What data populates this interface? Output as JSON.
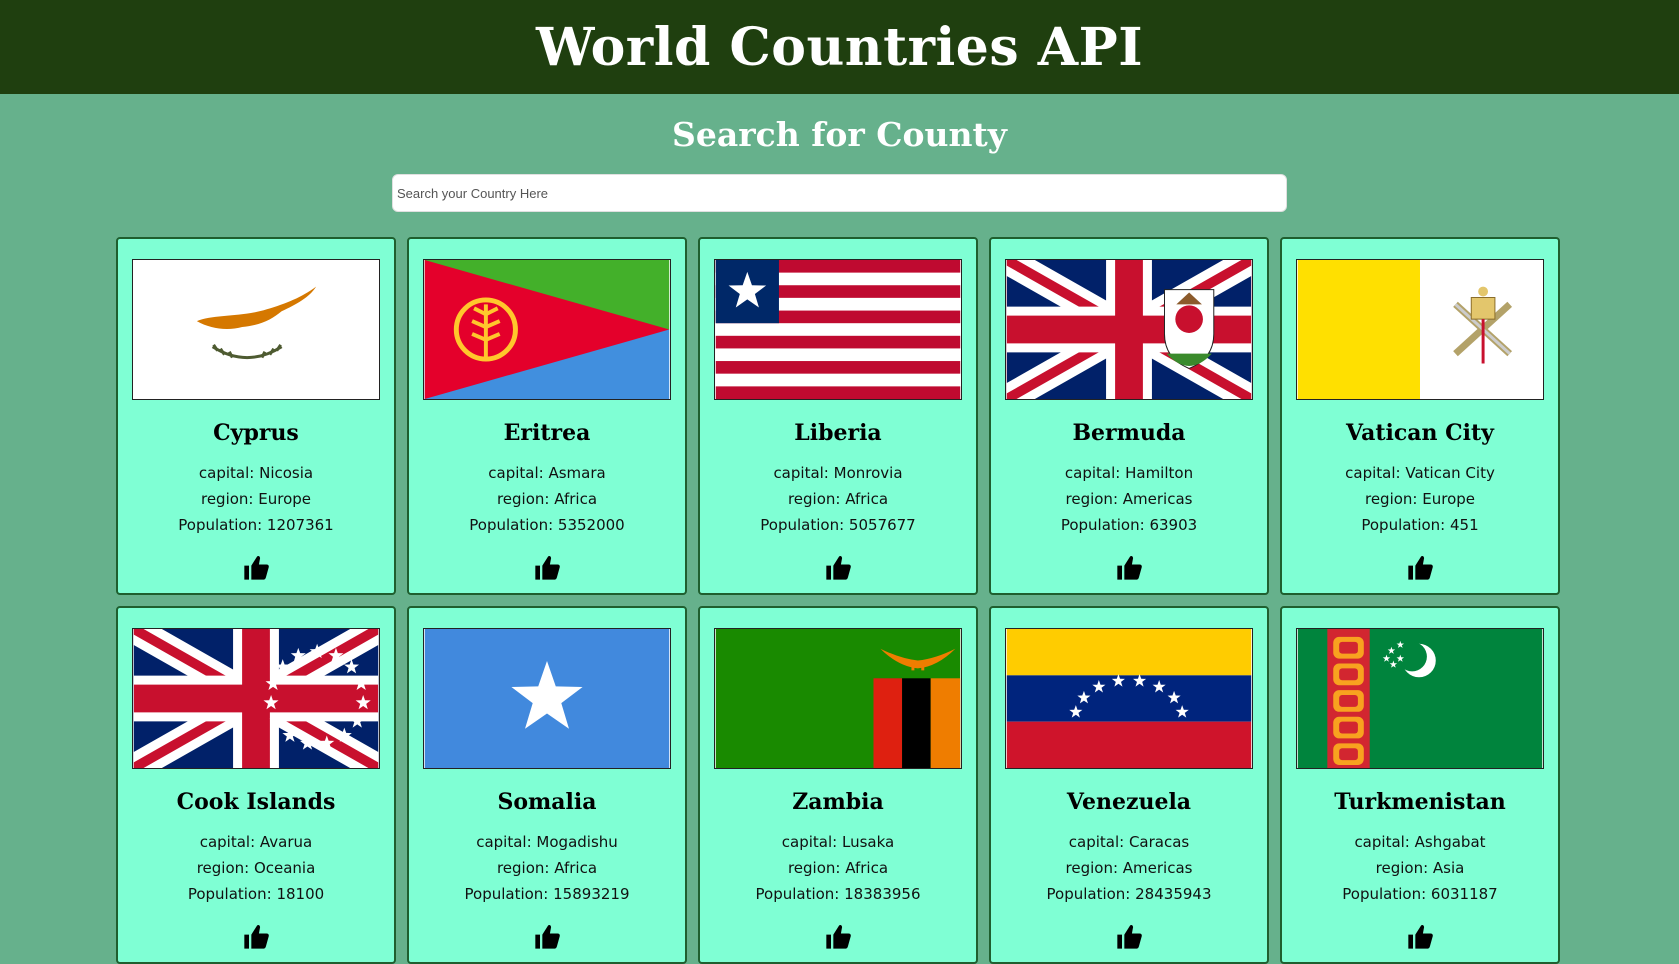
{
  "header": {
    "title": "World Countries API"
  },
  "search": {
    "heading": "Search for County",
    "placeholder": "Search your Country Here",
    "value": ""
  },
  "labels": {
    "capital": "capital: ",
    "region": "region: ",
    "population": "Population: "
  },
  "colors": {
    "header_bg": "#1f3f0f",
    "page_bg": "#66b18c",
    "card_bg": "#7fffd4"
  },
  "countries": [
    {
      "name": "Cyprus",
      "capital": "Nicosia",
      "region": "Europe",
      "population": "1207361",
      "flag": "cyprus"
    },
    {
      "name": "Eritrea",
      "capital": "Asmara",
      "region": "Africa",
      "population": "5352000",
      "flag": "eritrea"
    },
    {
      "name": "Liberia",
      "capital": "Monrovia",
      "region": "Africa",
      "population": "5057677",
      "flag": "liberia"
    },
    {
      "name": "Bermuda",
      "capital": "Hamilton",
      "region": "Americas",
      "population": "63903",
      "flag": "bermuda"
    },
    {
      "name": "Vatican City",
      "capital": "Vatican City",
      "region": "Europe",
      "population": "451",
      "flag": "vatican"
    },
    {
      "name": "Cook Islands",
      "capital": "Avarua",
      "region": "Oceania",
      "population": "18100",
      "flag": "cook-islands"
    },
    {
      "name": "Somalia",
      "capital": "Mogadishu",
      "region": "Africa",
      "population": "15893219",
      "flag": "somalia"
    },
    {
      "name": "Zambia",
      "capital": "Lusaka",
      "region": "Africa",
      "population": "18383956",
      "flag": "zambia"
    },
    {
      "name": "Venezuela",
      "capital": "Caracas",
      "region": "Americas",
      "population": "28435943",
      "flag": "venezuela"
    },
    {
      "name": "Turkmenistan",
      "capital": "Ashgabat",
      "region": "Asia",
      "population": "6031187",
      "flag": "turkmenistan"
    }
  ]
}
